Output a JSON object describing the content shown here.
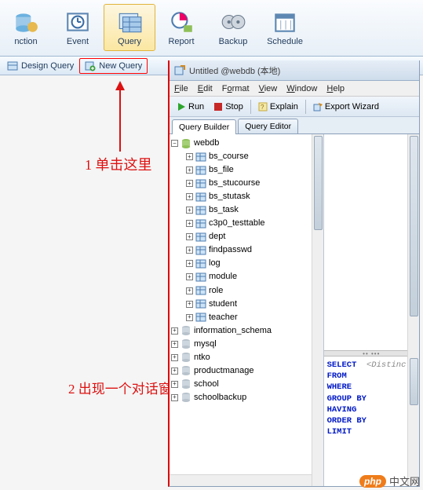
{
  "toolbar": [
    {
      "name": "nction-button",
      "label": "nction"
    },
    {
      "name": "event-button",
      "label": "Event"
    },
    {
      "name": "query-button",
      "label": "Query",
      "active": true
    },
    {
      "name": "report-button",
      "label": "Report"
    },
    {
      "name": "backup-button",
      "label": "Backup"
    },
    {
      "name": "schedule-button",
      "label": "Schedule"
    }
  ],
  "secondary": {
    "design_query": "Design Query",
    "new_query": "New Query"
  },
  "annotations": {
    "a1": "1 单击这里",
    "a2": "2 出现一个对话窗口"
  },
  "dialog": {
    "title": "Untitled @webdb (本地)",
    "menu": {
      "file": "File",
      "edit": "Edit",
      "format": "Format",
      "view": "View",
      "window": "Window",
      "help": "Help"
    },
    "actions": {
      "run": "Run",
      "stop": "Stop",
      "explain": "Explain",
      "export": "Export Wizard"
    },
    "tabs": {
      "builder": "Query Builder",
      "editor": "Query Editor"
    }
  },
  "tree": {
    "root": "webdb",
    "tables": [
      "bs_course",
      "bs_file",
      "bs_stucourse",
      "bs_stutask",
      "bs_task",
      "c3p0_testtable",
      "dept",
      "findpasswd",
      "log",
      "module",
      "role",
      "student",
      "teacher"
    ],
    "other_dbs": [
      "information_schema",
      "mysql",
      "ntko",
      "productmanage",
      "school",
      "schoolbackup"
    ]
  },
  "sql_keywords": [
    "SELECT",
    "FROM",
    "WHERE",
    "GROUP BY",
    "HAVING",
    "ORDER BY",
    "LIMIT"
  ],
  "sql_distinct": "<Distinct>",
  "watermark": {
    "badge": "php",
    "text": "中文网"
  },
  "splitter_dots": "••   •••"
}
